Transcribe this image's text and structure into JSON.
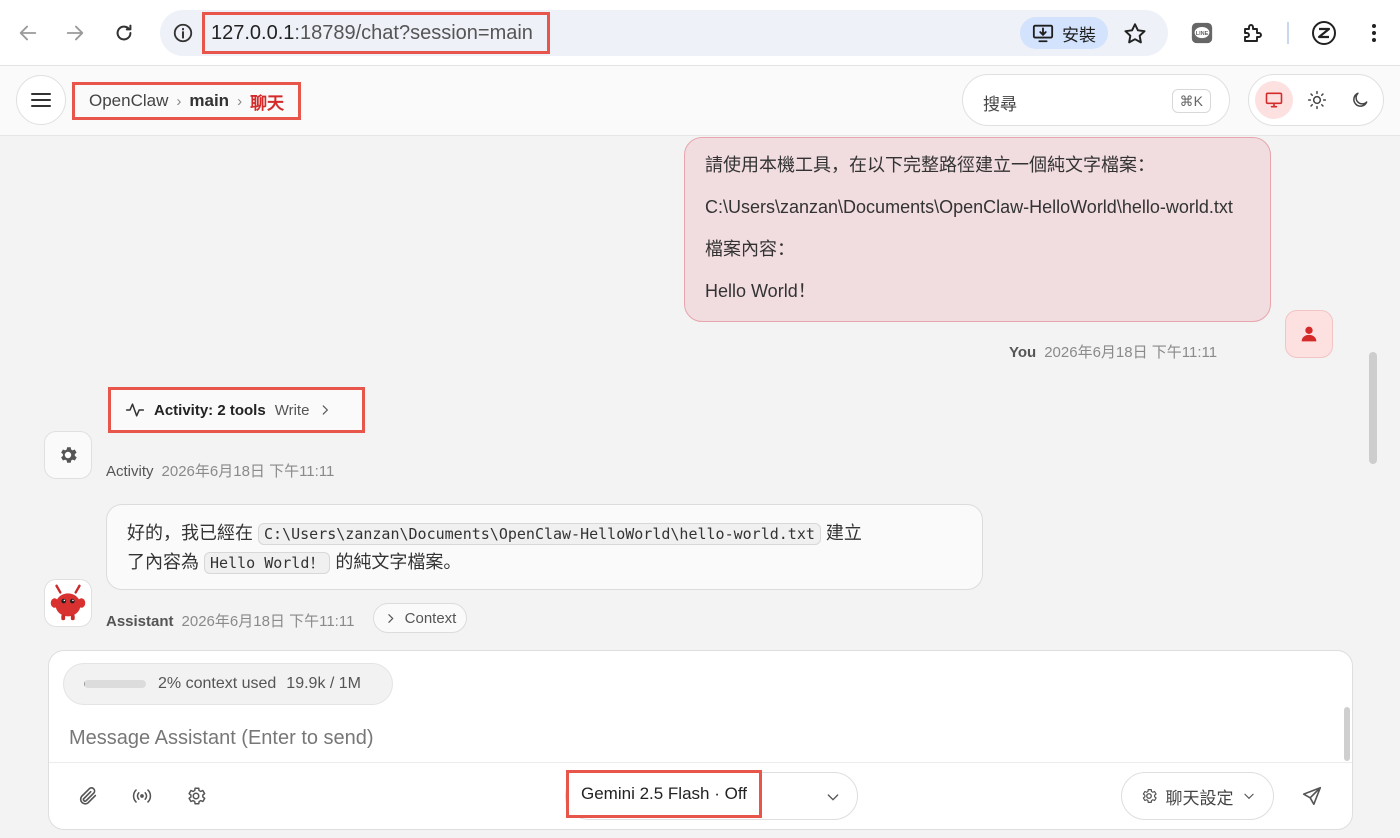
{
  "browser": {
    "url_host": "127.0.0.1",
    "url_rest": ":18789/chat?session=main",
    "install_label": "安裝"
  },
  "header": {
    "breadcrumb": [
      "OpenClaw",
      "main",
      "聊天"
    ],
    "search_placeholder": "搜尋",
    "search_shortcut": "⌘K",
    "accent_color": "#d42a2a"
  },
  "messages": {
    "user": {
      "lines": [
        "請使用本機工具，在以下完整路徑建立一個純文字檔案：",
        "C:\\Users\\zanzan\\Documents\\OpenClaw-HelloWorld\\hello-world.txt",
        "檔案內容：",
        "Hello World！"
      ],
      "sender": "You",
      "timestamp": "2026年6月18日 下午11:11"
    },
    "activity": {
      "label": "Activity: 2 tools",
      "tool": "Write",
      "sender": "Activity",
      "timestamp": "2026年6月18日 下午11:11"
    },
    "assistant": {
      "text_1": "好的，我已經在",
      "code_path": "C:\\Users\\zanzan\\Documents\\OpenClaw-HelloWorld\\hello-world.txt",
      "text_2": "建立",
      "text_3": "了內容為",
      "code_content": "Hello World！",
      "text_4": "的純文字檔案。",
      "sender": "Assistant",
      "timestamp": "2026年6月18日 下午11:11",
      "context_label": "Context"
    }
  },
  "composer": {
    "context_used_label": "2% context used",
    "context_tokens": "19.9k / 1M",
    "context_fraction": 0.02,
    "placeholder": "Message Assistant (Enter to send)",
    "model_label": "Gemini 2.5 Flash · Off",
    "settings_label": "聊天設定"
  }
}
